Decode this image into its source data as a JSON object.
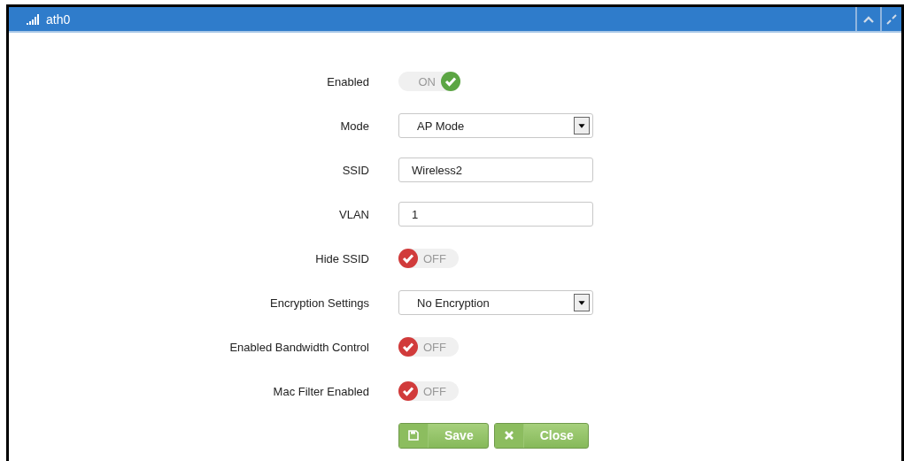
{
  "panel": {
    "title": "ath0"
  },
  "fields": [
    {
      "kind": "toggle",
      "label": "Enabled",
      "on": true,
      "text": "ON"
    },
    {
      "kind": "select",
      "label": "Mode",
      "value": "AP Mode"
    },
    {
      "kind": "text",
      "label": "SSID",
      "value": "Wireless2"
    },
    {
      "kind": "text",
      "label": "VLAN",
      "value": "1"
    },
    {
      "kind": "toggle",
      "label": "Hide SSID",
      "on": false,
      "text": "OFF"
    },
    {
      "kind": "select",
      "label": "Encryption Settings",
      "value": "No Encryption"
    },
    {
      "kind": "toggle",
      "label": "Enabled Bandwidth Control",
      "on": false,
      "text": "OFF"
    },
    {
      "kind": "toggle",
      "label": "Mac Filter Enabled",
      "on": false,
      "text": "OFF"
    }
  ],
  "buttons": [
    {
      "kind": "save",
      "label": "Save"
    },
    {
      "kind": "close",
      "label": "Close"
    }
  ]
}
